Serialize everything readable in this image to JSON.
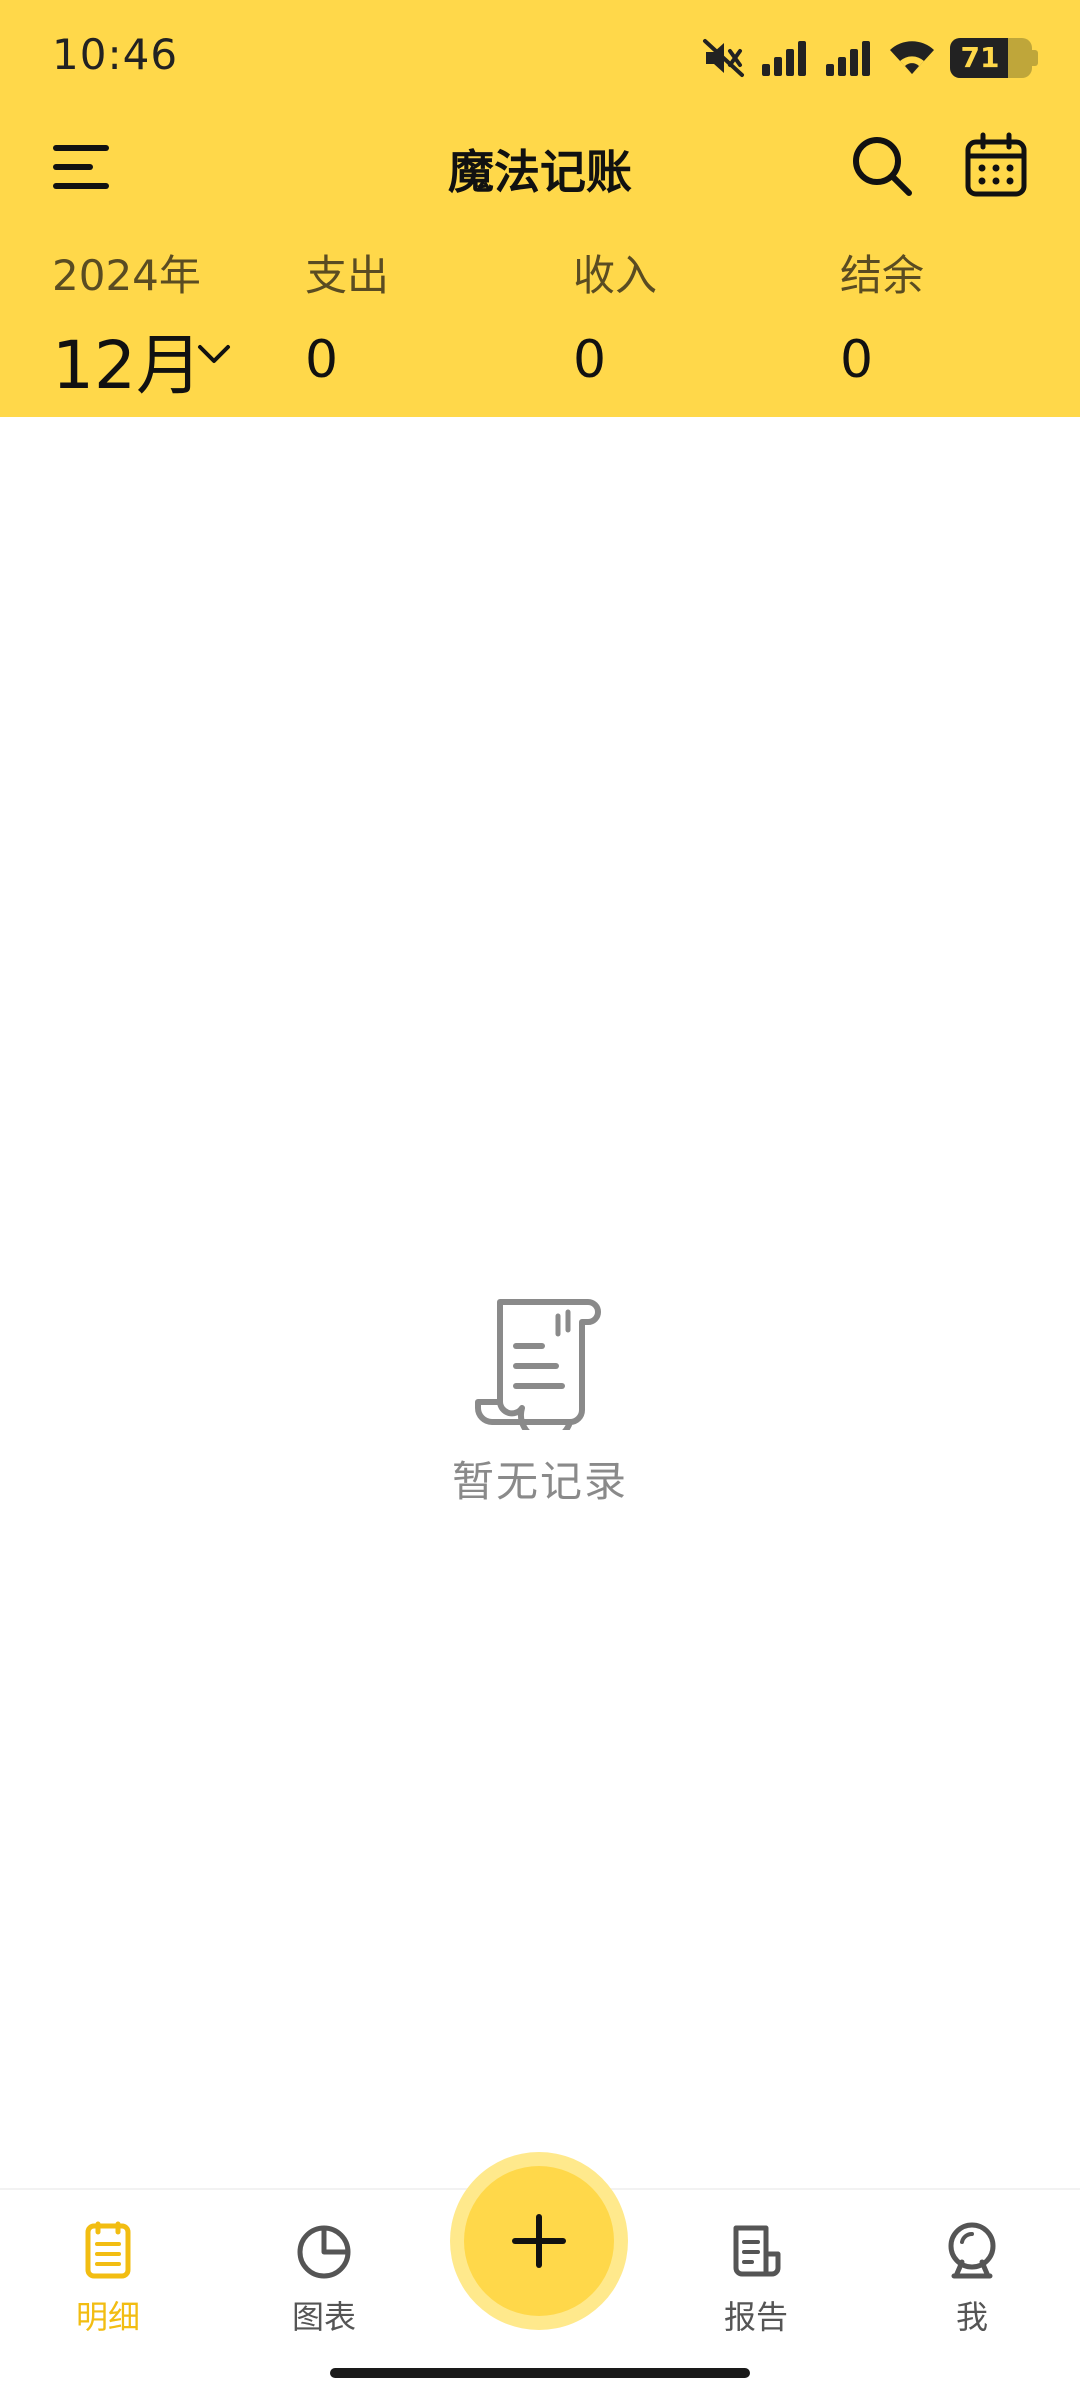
{
  "status_bar": {
    "time": "10:46",
    "battery_percent": "71",
    "battery_level": 0.71,
    "icons": [
      "mute-icon",
      "signal-icon",
      "signal-icon",
      "wifi-icon",
      "battery-icon"
    ]
  },
  "header": {
    "title": "魔法记账",
    "menu_icon": "menu-icon",
    "search_icon": "search-icon",
    "calendar_icon": "calendar-icon"
  },
  "summary": {
    "year": "2024年",
    "month": "12月",
    "expense_label": "支出",
    "expense_value": "0",
    "income_label": "收入",
    "income_value": "0",
    "balance_label": "结余",
    "balance_value": "0"
  },
  "empty_state": {
    "icon": "scroll-icon",
    "text": "暂无记录"
  },
  "bottom_nav": {
    "items": [
      {
        "label": "明细",
        "icon": "details-icon",
        "active": true
      },
      {
        "label": "图表",
        "icon": "chart-icon",
        "active": false
      },
      {
        "label": "报告",
        "icon": "report-icon",
        "active": false
      },
      {
        "label": "我",
        "icon": "profile-icon",
        "active": false
      }
    ],
    "add_icon": "plus-icon"
  },
  "colors": {
    "brand_yellow": "#FFD84A",
    "active_nav": "#F2BD12",
    "inactive_nav": "#555555",
    "empty_text": "#8a8a8a"
  }
}
